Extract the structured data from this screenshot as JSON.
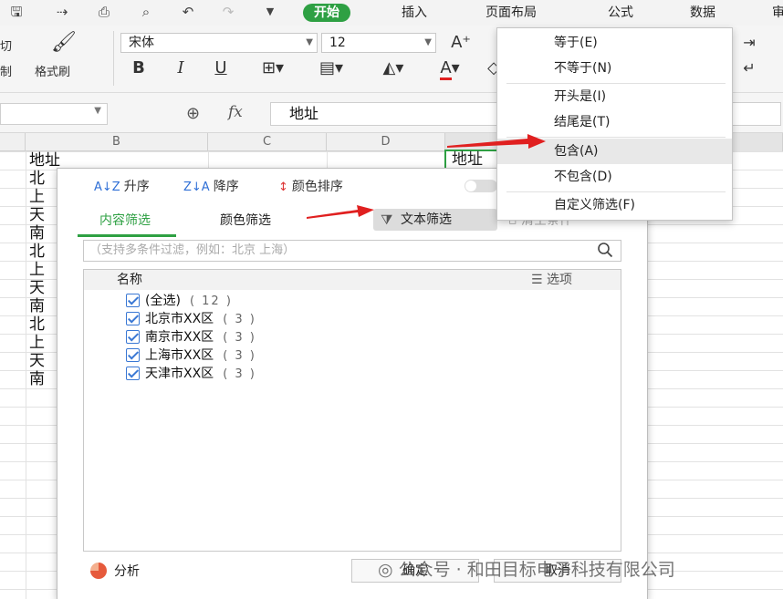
{
  "menu_tabs": {
    "start": "开始",
    "insert": "插入",
    "page_layout": "页面布局",
    "formula": "公式",
    "data": "数据",
    "review_partial": "审"
  },
  "ribbon": {
    "cut_partial": "切",
    "copy_partial": "制",
    "format_painter": "格式刷",
    "font_name": "宋体",
    "font_size": "12",
    "bold": "B",
    "italic": "I",
    "underline": "U"
  },
  "formula_bar": {
    "fx": "fx",
    "value": "地址"
  },
  "columns": [
    "B",
    "C",
    "D"
  ],
  "sheet": {
    "header": "地址",
    "selected_header": "地址",
    "rows": [
      "北",
      "上",
      "天",
      "南",
      "北",
      "上",
      "天",
      "南",
      "北",
      "上",
      "天",
      "南"
    ]
  },
  "filter_panel": {
    "sort_asc": "升序",
    "sort_desc": "降序",
    "sort_color": "颜色排序",
    "tab_content": "内容筛选",
    "tab_color": "颜色筛选",
    "text_filter": "文本筛选",
    "clear_condition": "清空条件",
    "search_placeholder": "（支持多条件过滤，例如：北京  上海）",
    "list_header_name": "名称",
    "list_header_options": "选项",
    "items": [
      {
        "label": "(全选)",
        "count": "( 12 )"
      },
      {
        "label": "北京市XX区",
        "count": "( 3 )"
      },
      {
        "label": "南京市XX区",
        "count": "( 3 )"
      },
      {
        "label": "上海市XX区",
        "count": "( 3 )"
      },
      {
        "label": "天津市XX区",
        "count": "( 3 )"
      }
    ],
    "analyze": "分析",
    "ok": "确定",
    "cancel": "取消"
  },
  "text_filter_menu": {
    "items": [
      "等于(E)",
      "不等于(N)",
      "开头是(I)",
      "结尾是(T)",
      "包含(A)",
      "不包含(D)",
      "自定义筛选(F)"
    ],
    "highlighted": "包含(A)"
  },
  "watermark": "公众号 · 和田目标电子科技有限公司",
  "colors": {
    "accent_green": "#2ea043",
    "check_blue": "#3a78d4",
    "arrow_red": "#e02020"
  }
}
